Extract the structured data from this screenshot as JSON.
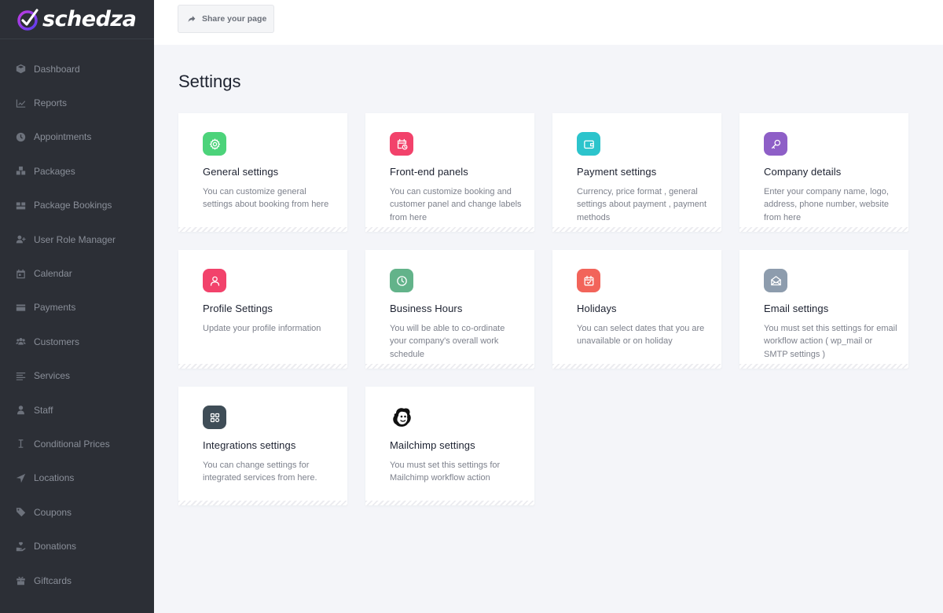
{
  "brand": {
    "name": "schedza",
    "accent": "#7b3ff2"
  },
  "sidebar": {
    "items": [
      {
        "label": "Dashboard",
        "icon": "cube-icon"
      },
      {
        "label": "Reports",
        "icon": "chart-icon"
      },
      {
        "label": "Appointments",
        "icon": "clock-icon"
      },
      {
        "label": "Packages",
        "icon": "boxes-icon"
      },
      {
        "label": "Package Bookings",
        "icon": "package-icon"
      },
      {
        "label": "User Role Manager",
        "icon": "user-plus-icon"
      },
      {
        "label": "Calendar",
        "icon": "calendar-icon"
      },
      {
        "label": "Payments",
        "icon": "wallet-icon"
      },
      {
        "label": "Customers",
        "icon": "users-icon"
      },
      {
        "label": "Services",
        "icon": "list-icon"
      },
      {
        "label": "Staff",
        "icon": "user-icon"
      },
      {
        "label": "Conditional Prices",
        "icon": "cursor-icon"
      },
      {
        "label": "Locations",
        "icon": "location-arrow-icon"
      },
      {
        "label": "Coupons",
        "icon": "tag-icon"
      },
      {
        "label": "Donations",
        "icon": "hand-heart-icon"
      },
      {
        "label": "Giftcards",
        "icon": "gift-icon"
      }
    ]
  },
  "topbar": {
    "share_label": "Share your page"
  },
  "main": {
    "title": "Settings",
    "cards": [
      {
        "title": "General settings",
        "desc": "You can customize general settings about booking from here",
        "icon": "gear-icon",
        "color": "#4cd37a"
      },
      {
        "title": "Front-end panels",
        "desc": "You can customize booking and customer panel and change labels from here",
        "icon": "calendar-clock-icon",
        "color": "#f2426b"
      },
      {
        "title": "Payment settings",
        "desc": "Currency, price format , general settings about payment , payment methods",
        "icon": "wallet-icon",
        "color": "#2cc4cc"
      },
      {
        "title": "Company details",
        "desc": "Enter your company name, logo, address, phone number, website from here",
        "icon": "key-icon",
        "color": "#8e5fc7"
      },
      {
        "title": "Profile Settings",
        "desc": "Update your profile information",
        "icon": "user-icon",
        "color": "#f2426b"
      },
      {
        "title": "Business Hours",
        "desc": "You will be able to co-ordinate your company's overall work schedule",
        "icon": "clock-icon",
        "color": "#63b38a"
      },
      {
        "title": "Holidays",
        "desc": "You can select dates that you are unavailable or on holiday",
        "icon": "calendar-check-icon",
        "color": "#f2645a"
      },
      {
        "title": "Email settings",
        "desc": "You must set this settings for email workflow action ( wp_mail or SMTP settings )",
        "icon": "envelope-open-icon",
        "color": "#8d9cad"
      },
      {
        "title": "Integrations settings",
        "desc": "You can change settings for integrated services from here.",
        "icon": "integrations-icon",
        "color": "#3f4d57"
      },
      {
        "title": "Mailchimp settings",
        "desc": "You must set this settings for Mailchimp workflow action",
        "icon": "mailchimp-icon",
        "color": "#ffffff"
      }
    ]
  }
}
